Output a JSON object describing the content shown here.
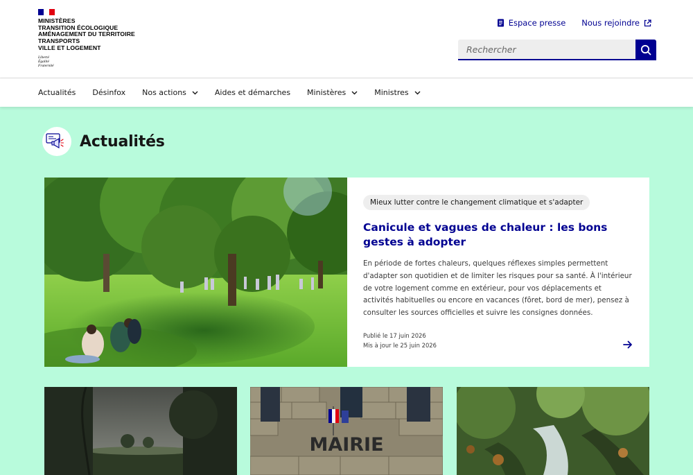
{
  "header": {
    "logo": {
      "lines": [
        "MINISTÈRES",
        "TRANSITION ÉCOLOGIQUE",
        "AMÉNAGEMENT DU TERRITOIRE",
        "TRANSPORTS",
        "VILLE ET LOGEMENT"
      ],
      "motto": [
        "Liberté",
        "Égalité",
        "Fraternité"
      ]
    },
    "links": {
      "press": "Espace presse",
      "join": "Nous rejoindre"
    },
    "search": {
      "placeholder": "Rechercher"
    }
  },
  "nav": {
    "items": [
      {
        "label": "Actualités",
        "has_dropdown": false
      },
      {
        "label": "Désinfox",
        "has_dropdown": false
      },
      {
        "label": "Nos actions",
        "has_dropdown": true
      },
      {
        "label": "Aides et démarches",
        "has_dropdown": false
      },
      {
        "label": "Ministères",
        "has_dropdown": true
      },
      {
        "label": "Ministres",
        "has_dropdown": true
      }
    ]
  },
  "page": {
    "title": "Actualités"
  },
  "featured": {
    "tag": "Mieux lutter contre le changement climatique et s'adapter",
    "title": "Canicule et vagues de chaleur : les bons gestes à adopter",
    "description": "En période de fortes chaleurs, quelques réflexes simples permettent d'adapter son quotidien et de limiter les risques pour sa santé. À l'intérieur de votre logement comme en extérieur, pour vos déplacements et activités habituelles ou encore en vacances (fôret, bord de mer), pensez à consulter les sources officielles et suivre les consignes données.",
    "published": "Publié le 17 juin 2026",
    "updated": "Mis à jour le 25 juin 2026"
  },
  "cards": {
    "mairie_sign": "MAIRIE"
  },
  "colors": {
    "background": "#b8fbdc",
    "accent": "#000091",
    "marianne_red": "#e1000f"
  },
  "icons": [
    "external-link-icon",
    "document-icon",
    "search-icon",
    "chevron-down-icon",
    "megaphone-icon",
    "arrow-right-icon"
  ]
}
